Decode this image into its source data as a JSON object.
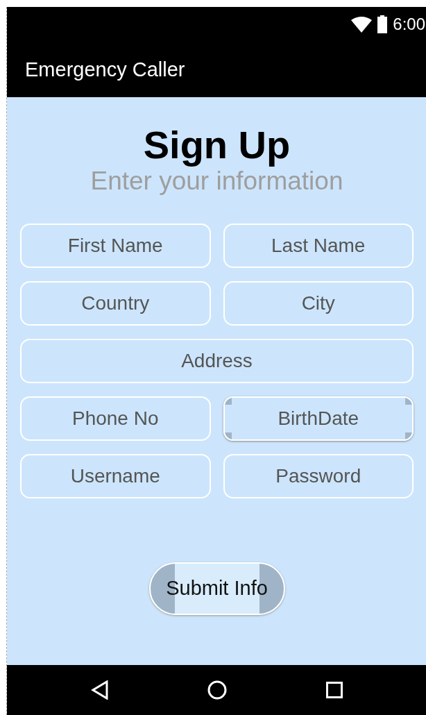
{
  "status_bar": {
    "time": "6:00"
  },
  "app_bar": {
    "title": "Emergency Caller"
  },
  "heading": "Sign Up",
  "subheading": "Enter your information",
  "form_rows": [
    [
      {
        "placeholder": "First Name",
        "kind": "text"
      },
      {
        "placeholder": "Last Name",
        "kind": "text"
      }
    ],
    [
      {
        "placeholder": "Country",
        "kind": "text"
      },
      {
        "placeholder": "City",
        "kind": "text"
      }
    ],
    [
      {
        "placeholder": "Address",
        "kind": "text"
      }
    ],
    [
      {
        "placeholder": "Phone No",
        "kind": "text"
      },
      {
        "placeholder": "BirthDate",
        "kind": "date"
      }
    ],
    [
      {
        "placeholder": "Username",
        "kind": "text"
      },
      {
        "placeholder": "Password",
        "kind": "text"
      }
    ]
  ],
  "submit_button": "Submit Info"
}
